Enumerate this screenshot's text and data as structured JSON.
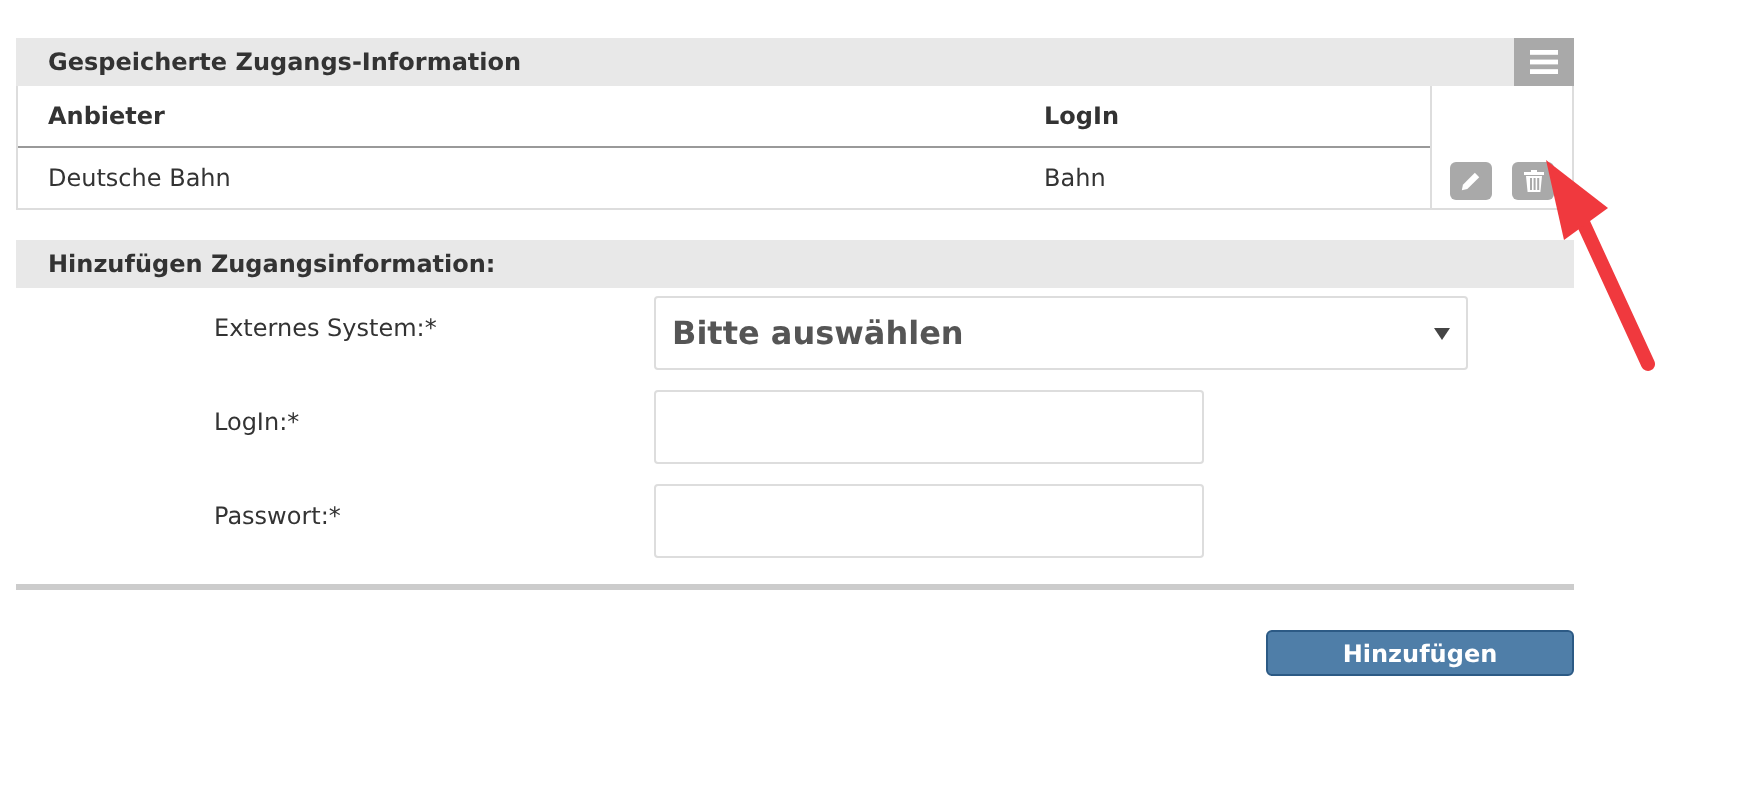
{
  "saved_panel": {
    "title": "Gespeicherte Zugangs-Information",
    "table": {
      "columns": [
        "Anbieter",
        "LogIn"
      ],
      "rows": [
        {
          "cells": [
            "Deutsche Bahn",
            "Bahn"
          ]
        }
      ]
    }
  },
  "add_panel": {
    "title": "Hinzufügen Zugangsinformation:",
    "fields": [
      {
        "kind": "select",
        "label": "Externes System:*",
        "value": "Bitte auswählen"
      },
      {
        "kind": "text",
        "label": "LogIn:*"
      },
      {
        "kind": "password",
        "label": "Passwort:*"
      }
    ]
  },
  "buttons": [
    "Hinzufügen"
  ]
}
